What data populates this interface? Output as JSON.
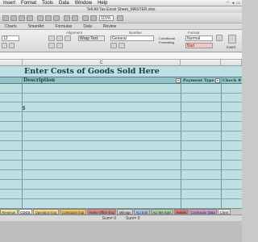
{
  "menubar": {
    "items": [
      "Insert",
      "Format",
      "Tools",
      "Data",
      "Window",
      "Help"
    ],
    "right_icons": [
      "wifi-icon",
      "volume-icon",
      "battery-icon"
    ]
  },
  "window": {
    "title": "Tell All Tax Excel Sheet_MASTER.xlsx"
  },
  "toolbar": {
    "zoom": "115%"
  },
  "ribbon_tabs": [
    "Charts",
    "SmartArt",
    "Formulas",
    "Data",
    "Review"
  ],
  "ribbon": {
    "alignment_group": "Alignment",
    "number_group": "Number",
    "format_group": "Format",
    "font_size": "12",
    "wrap_text": "Wrap Text",
    "number_format": "General",
    "style_normal": "Normal",
    "style_bad": "Bad",
    "conditional_formatting": "Conditional Formatting",
    "insert_label": "Insert"
  },
  "grid": {
    "column_c": "C",
    "title": "Enter Costs of Goods Sold Here",
    "headers": {
      "description": "Description",
      "payment_type": "Payment Type",
      "check": "Check #"
    },
    "dollar_cell": "$"
  },
  "sheet_tabs": [
    {
      "label": "Revenue",
      "color": "#e9e9a0"
    },
    {
      "label": "COGS",
      "color": "#ffffff"
    },
    {
      "label": "Operation Exp",
      "color": "#f2e08a"
    },
    {
      "label": "Contractor Exp",
      "color": "#f3c85a"
    },
    {
      "label": "Home Office Exp",
      "color": "#d98a8a"
    },
    {
      "label": "Mileage",
      "color": "#d6d6d6"
    },
    {
      "label": "ALI Exh",
      "color": "#a8c8e8"
    },
    {
      "label": "ALI MA Sum",
      "color": "#a8d4a8"
    },
    {
      "label": "Assets",
      "color": "#d47a7a"
    },
    {
      "label": "Contractor Data",
      "color": "#c8a0d8"
    },
    {
      "label": "Client",
      "color": "#e8e8e8"
    }
  ],
  "statusbar": {
    "sum_left": "Sum= 0",
    "sum_right": "Sum= 0"
  },
  "colors": {
    "sheet_bg": "#bfe0e2",
    "header_row": "#93c5c8",
    "title_text": "#1c3e45"
  }
}
